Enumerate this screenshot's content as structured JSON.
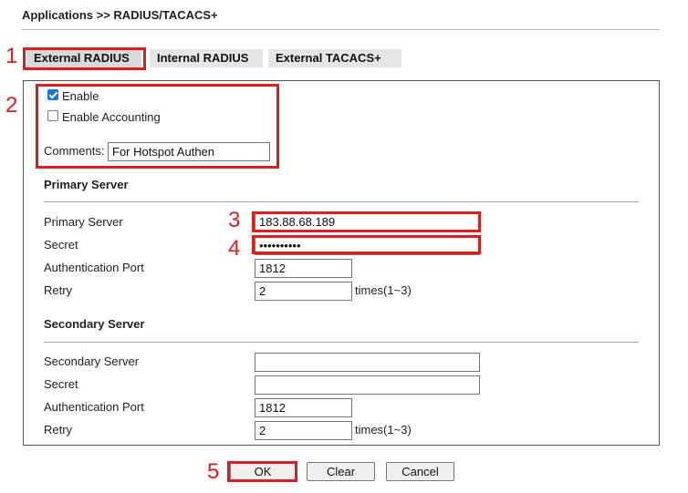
{
  "breadcrumb": "Applications >> RADIUS/TACACS+",
  "tabs": [
    {
      "label": "External RADIUS",
      "active": true
    },
    {
      "label": "Internal RADIUS",
      "active": false
    },
    {
      "label": "External TACACS+",
      "active": false
    }
  ],
  "general": {
    "enable_label": "Enable",
    "enable_checked": true,
    "accounting_label": "Enable Accounting",
    "accounting_checked": false,
    "comments_label": "Comments:",
    "comments_value": "For Hotspot Authen"
  },
  "primary": {
    "title": "Primary Server",
    "server_label": "Primary Server",
    "server_value": "183.88.68.189",
    "secret_label": "Secret",
    "secret_value": "••••••••••",
    "port_label": "Authentication Port",
    "port_value": "1812",
    "retry_label": "Retry",
    "retry_value": "2",
    "retry_unit": "times(1~3)"
  },
  "secondary": {
    "title": "Secondary Server",
    "server_label": "Secondary Server",
    "server_value": "",
    "secret_label": "Secret",
    "secret_value": "",
    "port_label": "Authentication Port",
    "port_value": "1812",
    "retry_label": "Retry",
    "retry_value": "2",
    "retry_unit": "times(1~3)"
  },
  "buttons": {
    "ok": "OK",
    "clear": "Clear",
    "cancel": "Cancel"
  },
  "annotations": [
    "1",
    "2",
    "3",
    "4",
    "5"
  ],
  "colors": {
    "highlight": "#e01c1c",
    "checkbox": "#1a73e8"
  }
}
